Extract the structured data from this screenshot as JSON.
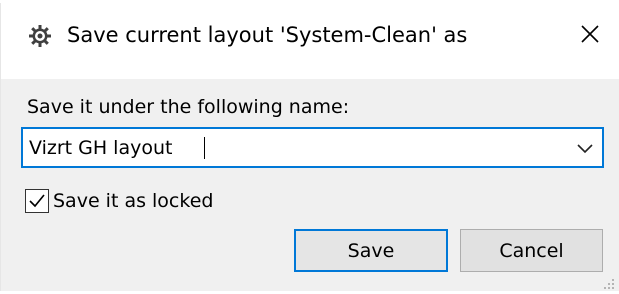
{
  "dialog": {
    "title": "Save current layout 'System-Clean' as",
    "icon": "gear-icon",
    "close_icon": "close-icon"
  },
  "form": {
    "prompt": "Save it under the following name:",
    "name_value": "Vizrt GH layout",
    "dropdown_icon": "chevron-down-icon",
    "locked_checked": true,
    "locked_label": "Save it as locked"
  },
  "buttons": {
    "save_label": "Save",
    "cancel_label": "Cancel"
  },
  "colors": {
    "accent": "#0078d7",
    "window_bg": "#f0f0f0",
    "titlebar_bg": "#ffffff"
  }
}
